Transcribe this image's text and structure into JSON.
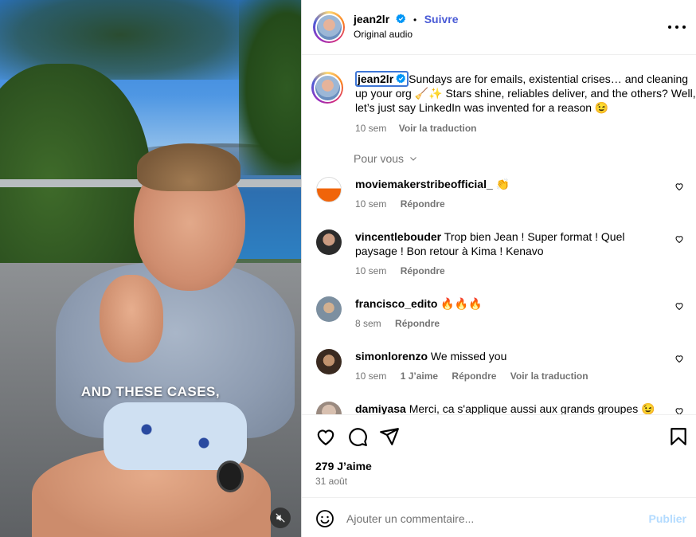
{
  "media": {
    "caption_overlay": "AND THESE CASES,"
  },
  "header": {
    "username": "jean2lr",
    "separator": "•",
    "follow_label": "Suivre",
    "subtitle": "Original audio"
  },
  "post_caption": {
    "username": "jean2lr",
    "text": "Sundays are for emails, existential crises… and cleaning up your org 🧹✨ Stars shine, reliables deliver, and the others? Well, let’s just say LinkedIn was invented for a reason 😉",
    "time": "10 sem",
    "translate": "Voir la traduction"
  },
  "sort_label": "Pour vous",
  "comments": [
    {
      "username": "moviemakerstribeofficial_",
      "text": "👏",
      "time": "10 sem",
      "likes": "",
      "reply": "Répondre",
      "translate": ""
    },
    {
      "username": "vincentlebouder",
      "text": "Trop bien Jean ! Super format ! Quel paysage ! Bon retour à Kima ! Kenavo",
      "time": "10 sem",
      "likes": "",
      "reply": "Répondre",
      "translate": ""
    },
    {
      "username": "francisco_edito",
      "text": "🔥🔥🔥",
      "time": "8 sem",
      "likes": "",
      "reply": "Répondre",
      "translate": ""
    },
    {
      "username": "simonlorenzo",
      "text": "We missed you",
      "time": "10 sem",
      "likes": "1 J’aime",
      "reply": "Répondre",
      "translate": "Voir la traduction"
    },
    {
      "username": "damiyasa",
      "text": "Merci, ca s'applique aussi aux grands groupes 😉",
      "time": "",
      "likes": "",
      "reply": "",
      "translate": ""
    }
  ],
  "actions": {
    "likes": "279 J’aime",
    "date": "31 août"
  },
  "composer": {
    "placeholder": "Ajouter un commentaire...",
    "publish_label": "Publier"
  },
  "colors": {
    "accent": "#0095f6",
    "muted": "#737373",
    "publish_disabled": "#b3dbff",
    "focus_outline": "#3e76d6"
  },
  "icons": [
    "verified-icon",
    "more-icon",
    "chevron-down-icon",
    "heart-icon",
    "comment-icon",
    "share-icon",
    "bookmark-icon",
    "emoji-icon",
    "mute-icon"
  ]
}
